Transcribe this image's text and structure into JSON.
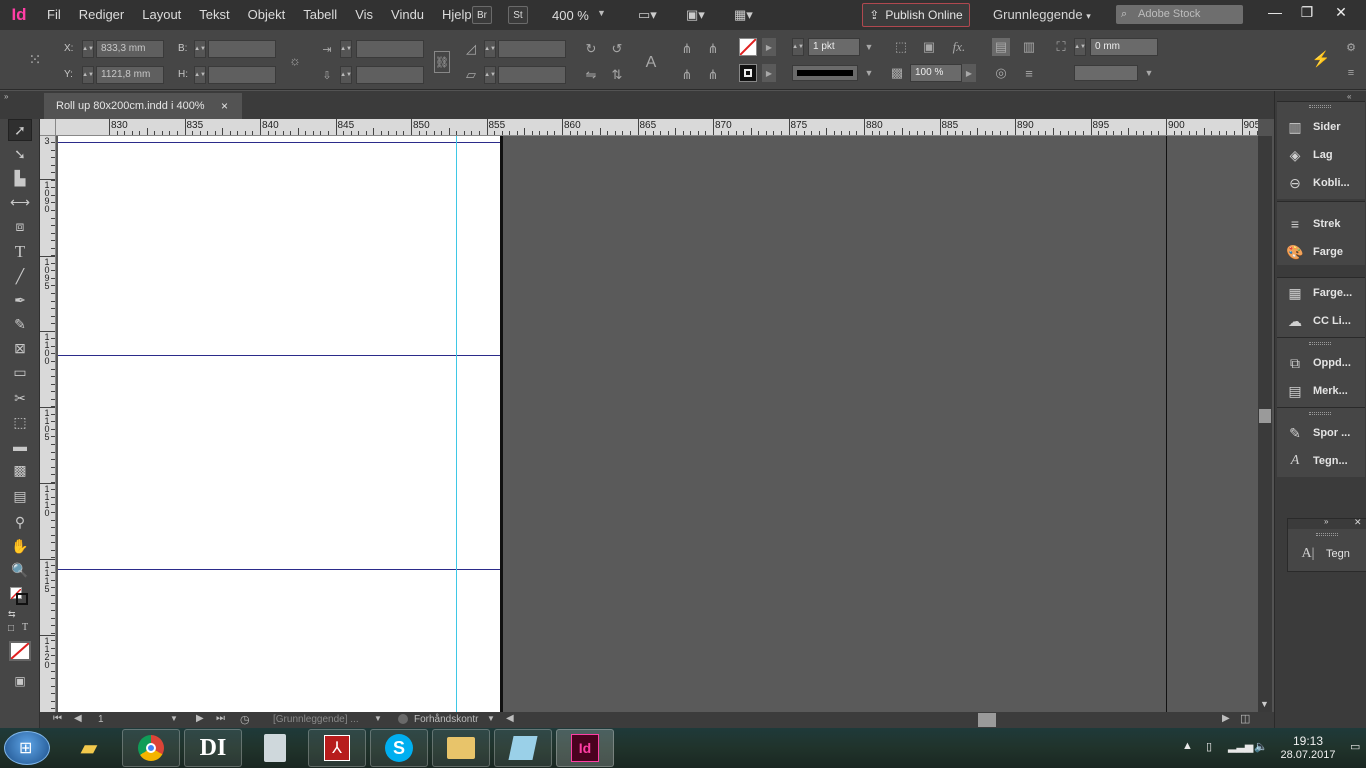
{
  "app": {
    "logo": "Id"
  },
  "menubar": {
    "items": [
      "Fil",
      "Rediger",
      "Layout",
      "Tekst",
      "Objekt",
      "Tabell",
      "Vis",
      "Vindu",
      "Hjelp"
    ],
    "bridge": "Br",
    "stock_btn": "St",
    "zoom": "400 %",
    "publish_label": "Publish Online",
    "workspace": "Grunnleggende",
    "search_placeholder": "Adobe Stock"
  },
  "control": {
    "x_label": "X:",
    "x_value": "833,3 mm",
    "y_label": "Y:",
    "y_value": "1121,8 mm",
    "w_label": "B:",
    "h_label": "H:",
    "stroke_weight": "1 pkt",
    "opacity": "100 %",
    "offset": "0 mm"
  },
  "document": {
    "tab_title": "Roll up 80x200cm.indd i 400%",
    "close": "×"
  },
  "ruler": {
    "h_labels": [
      "830",
      "835",
      "840",
      "845",
      "850",
      "855",
      "860",
      "865",
      "870",
      "875",
      "880",
      "885",
      "890",
      "895",
      "900",
      "905"
    ],
    "v_labels": [
      "3",
      "1090",
      "1095",
      "1100",
      "1105",
      "1110",
      "1115",
      "1120"
    ]
  },
  "statusbar": {
    "page": "1",
    "master": "[Grunnleggende] ...",
    "preflight": "Forhåndskontr"
  },
  "panels": {
    "group1": [
      "Sider",
      "Lag",
      "Kobli..."
    ],
    "group2": [
      "Strek",
      "Farge"
    ],
    "group3": [
      "Farge...",
      "CC Li..."
    ],
    "group4": [
      "Oppd...",
      "Merk..."
    ],
    "group5": [
      "Spor ...",
      "Tegn..."
    ],
    "floating": "Tegn"
  },
  "taskbar": {
    "time": "19:13",
    "date": "28.07.2017",
    "apps": [
      "file-explorer-folder",
      "chrome",
      "di",
      "calculator",
      "acrobat",
      "skype",
      "explorer",
      "notepad",
      "indesign"
    ]
  },
  "colors": {
    "accent": "#ff3ea5",
    "guide": "#3ec8e6",
    "margin": "#2b2b8a",
    "publish_border": "#b0484f"
  }
}
